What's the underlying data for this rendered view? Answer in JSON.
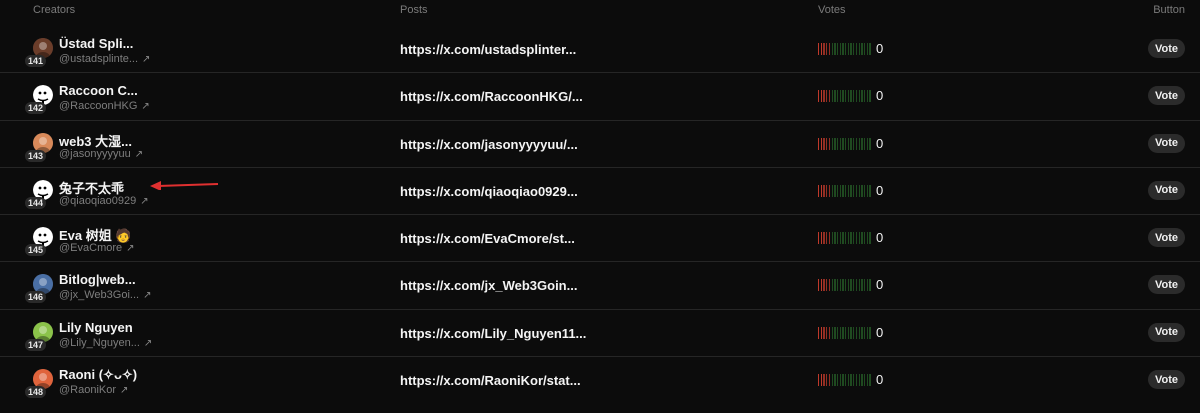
{
  "header": {
    "creators": "Creators",
    "posts": "Posts",
    "votes": "Votes",
    "button": "Button"
  },
  "colors": {
    "vote_bar_red": "#c0392b",
    "vote_bar_green": "#2f7d32",
    "background": "#0c0c0c"
  },
  "rows": [
    {
      "rank": "141",
      "name": "Üstad Spli...",
      "handle": "@ustadsplinte...",
      "ext_icon": "↗",
      "post": "https://x.com/ustadsplinter...",
      "votes": "0",
      "vote_label": "Vote",
      "avatar_icon": "photo-avatar-icon",
      "avatar_color": "#6b3d2a"
    },
    {
      "rank": "142",
      "name": "Raccoon C...",
      "handle": "@RaccoonHKG",
      "ext_icon": "↗",
      "post": "https://x.com/RaccoonHKG/...",
      "votes": "0",
      "vote_label": "Vote",
      "avatar_icon": "default-avatar-icon",
      "avatar_color": "#ffffff"
    },
    {
      "rank": "143",
      "name": "web3 大湿...",
      "handle": "@jasonyyyyuu",
      "ext_icon": "↗",
      "post": "https://x.com/jasonyyyyuu/...",
      "votes": "0",
      "vote_label": "Vote",
      "avatar_icon": "photo-avatar-icon",
      "avatar_color": "#d98a5a"
    },
    {
      "rank": "144",
      "name": "兔子不太乖",
      "handle": "@qiaoqiao0929",
      "ext_icon": "↗",
      "post": "https://x.com/qiaoqiao0929...",
      "votes": "0",
      "vote_label": "Vote",
      "avatar_icon": "default-avatar-icon",
      "avatar_color": "#ffffff"
    },
    {
      "rank": "145",
      "name": "Eva 树姐",
      "name_emoji": "🧑",
      "handle": "@EvaCmore",
      "ext_icon": "↗",
      "post": "https://x.com/EvaCmore/st...",
      "votes": "0",
      "vote_label": "Vote",
      "avatar_icon": "default-avatar-icon",
      "avatar_color": "#ffffff"
    },
    {
      "rank": "146",
      "name": "Bitlog|web...",
      "handle": "@jx_Web3Goi...",
      "ext_icon": "↗",
      "post": "https://x.com/jx_Web3Goin...",
      "votes": "0",
      "vote_label": "Vote",
      "avatar_icon": "photo-avatar-icon",
      "avatar_color": "#4a6fa5"
    },
    {
      "rank": "147",
      "name": "Lily Nguyen",
      "handle": "@Lily_Nguyen...",
      "ext_icon": "↗",
      "post": "https://x.com/Lily_Nguyen11...",
      "votes": "0",
      "vote_label": "Vote",
      "avatar_icon": "photo-avatar-icon",
      "avatar_color": "#8bc34a"
    },
    {
      "rank": "148",
      "name": "Raoni (✧ᴗ✧)",
      "handle": "@RaoniKor",
      "ext_icon": "↗",
      "post": "https://x.com/RaoniKor/stat...",
      "votes": "0",
      "vote_label": "Vote",
      "avatar_icon": "photo-avatar-icon",
      "avatar_color": "#e0643c"
    }
  ]
}
